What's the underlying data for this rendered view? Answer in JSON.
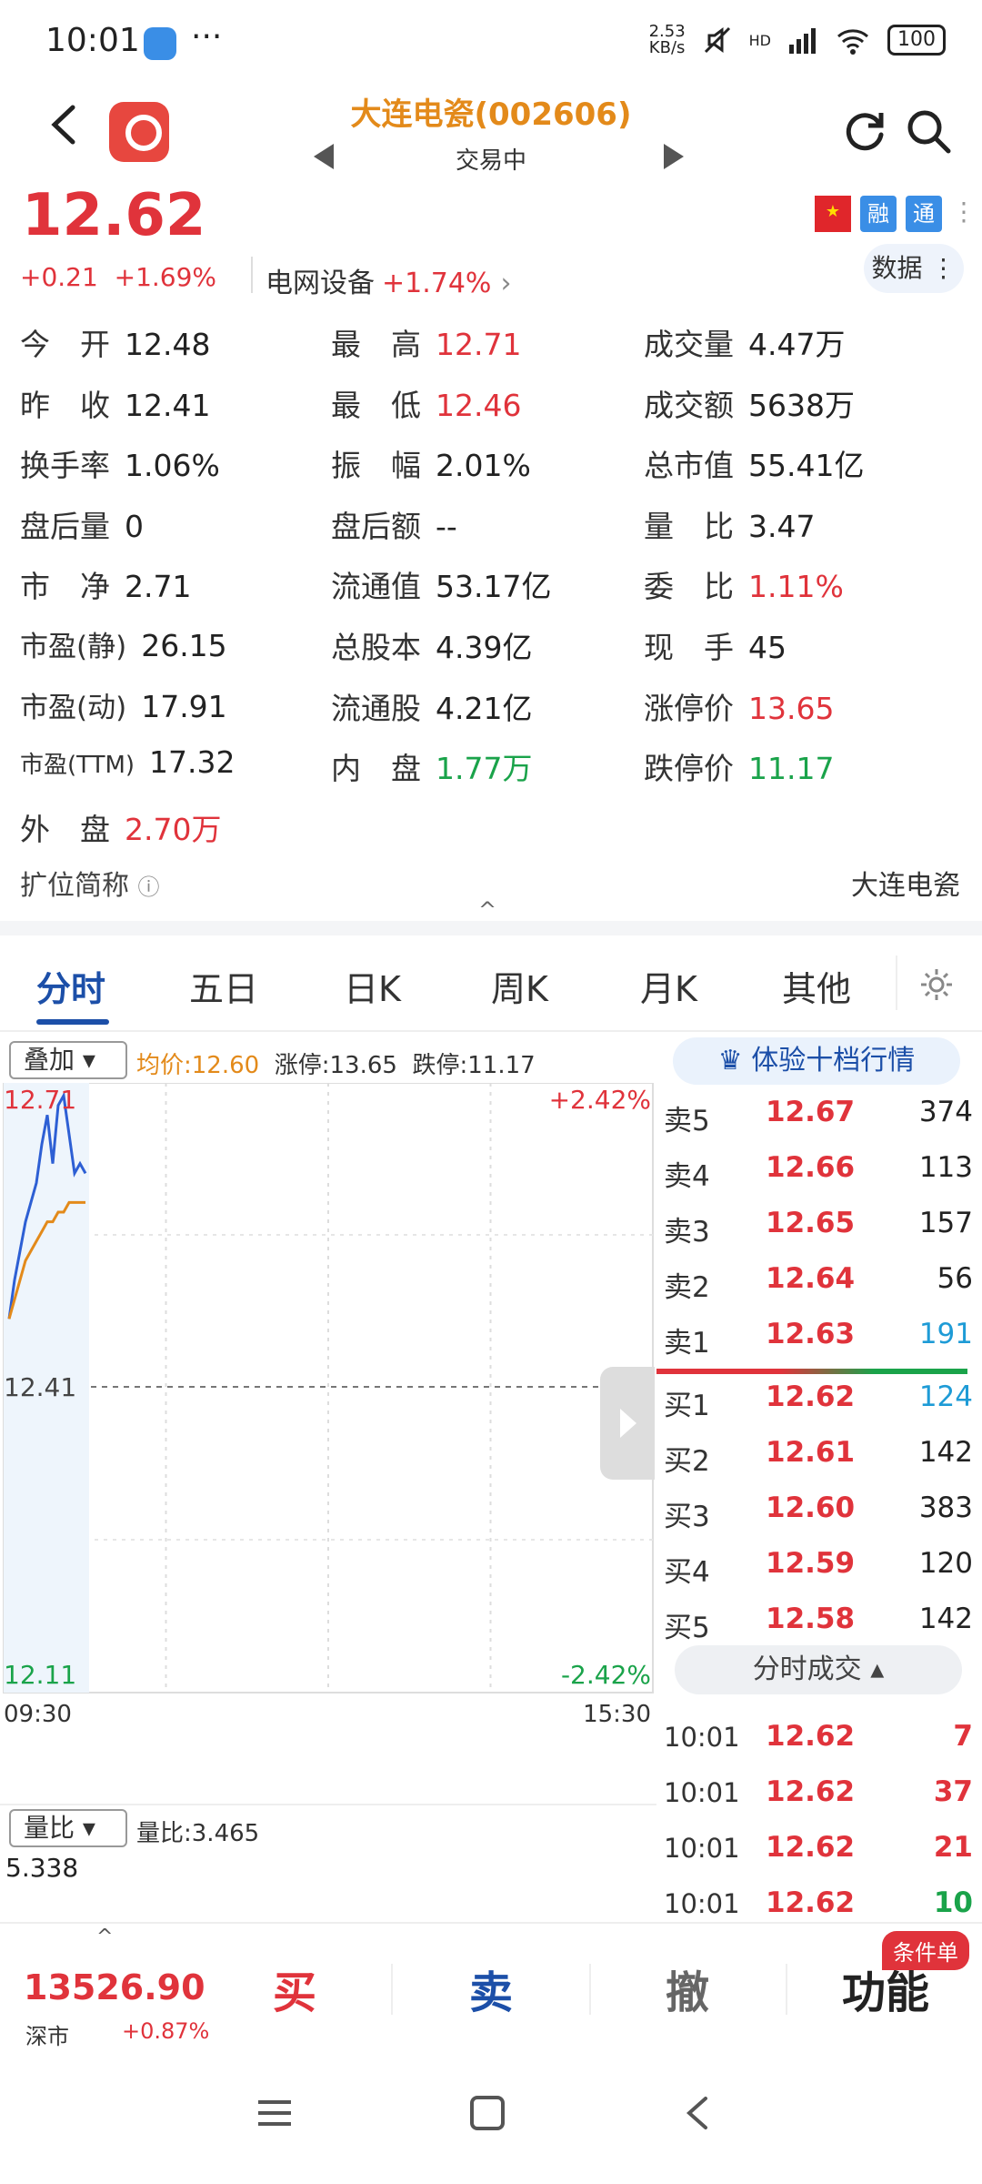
{
  "status_bar": {
    "time": "10:01",
    "more": "···",
    "net_speed_top": "2.53",
    "net_speed_unit": "KB/s",
    "hd": "HD",
    "battery": "100"
  },
  "header": {
    "title": "大连电瓷(002606)",
    "subtitle": "交易中"
  },
  "quote": {
    "price": "12.62",
    "change": "+0.21",
    "change_pct": "+1.69%",
    "sector_name": "电网设备",
    "sector_pct": "+1.74%",
    "data_btn": "数据",
    "badge_rong": "融",
    "badge_tong": "通"
  },
  "stats": [
    {
      "k": "今　开",
      "v": "12.48"
    },
    {
      "k": "最　高",
      "v": "12.71",
      "c": "red"
    },
    {
      "k": "成交量",
      "v": "4.47万"
    },
    {
      "k": "昨　收",
      "v": "12.41"
    },
    {
      "k": "最　低",
      "v": "12.46",
      "c": "red"
    },
    {
      "k": "成交额",
      "v": "5638万"
    },
    {
      "k": "换手率",
      "v": "1.06%"
    },
    {
      "k": "振　幅",
      "v": "2.01%"
    },
    {
      "k": "总市值",
      "v": "55.41亿"
    },
    {
      "k": "盘后量",
      "v": "0"
    },
    {
      "k": "盘后额",
      "v": "--"
    },
    {
      "k": "量　比",
      "v": "3.47"
    },
    {
      "k": "市　净",
      "v": "2.71"
    },
    {
      "k": "流通值",
      "v": "53.17亿"
    },
    {
      "k": "委　比",
      "v": "1.11%",
      "c": "red"
    },
    {
      "k": "市盈(静)",
      "v": "26.15"
    },
    {
      "k": "总股本",
      "v": "4.39亿"
    },
    {
      "k": "现　手",
      "v": "45"
    },
    {
      "k": "市盈(动)",
      "v": "17.91"
    },
    {
      "k": "流通股",
      "v": "4.21亿"
    },
    {
      "k": "涨停价",
      "v": "13.65",
      "c": "red"
    },
    {
      "k": "市盈(TTM)",
      "v": "17.32"
    },
    {
      "k": "内　盘",
      "v": "1.77万",
      "c": "green"
    },
    {
      "k": "跌停价",
      "v": "11.17",
      "c": "green"
    },
    {
      "k": "外　盘",
      "v": "2.70万",
      "c": "red"
    }
  ],
  "extension": {
    "label": "扩位简称",
    "value": "大连电瓷"
  },
  "tabs": [
    "分时",
    "五日",
    "日K",
    "周K",
    "月K",
    "其他"
  ],
  "chart": {
    "overlay_dropdown": "叠加",
    "avg_label": "均价:12.60",
    "limit_up_label": "涨停:13.65",
    "limit_down_label": "跌停:11.17",
    "y_high": "12.71",
    "y_mid": "12.41",
    "y_low": "12.11",
    "pct_high": "+2.42%",
    "pct_low": "-2.42%",
    "time_start": "09:30",
    "time_end": "15:30",
    "volratio_dropdown": "量比",
    "volratio_label": "量比:3.465",
    "volratio_max": "5.338"
  },
  "chart_data": {
    "type": "line",
    "ylim": [
      12.11,
      12.71
    ],
    "series": [
      {
        "name": "price",
        "values": [
          12.48,
          12.52,
          12.55,
          12.58,
          12.6,
          12.62,
          12.66,
          12.69,
          12.64,
          12.7,
          12.71,
          12.67,
          12.63,
          12.64,
          12.63
        ]
      },
      {
        "name": "avg",
        "values": [
          12.48,
          12.5,
          12.52,
          12.54,
          12.55,
          12.56,
          12.57,
          12.58,
          12.58,
          12.59,
          12.59,
          12.6,
          12.6,
          12.6,
          12.6
        ]
      }
    ]
  },
  "orderbook": {
    "header": "体验十档行情",
    "asks": [
      {
        "label": "卖5",
        "price": "12.67",
        "vol": "374"
      },
      {
        "label": "卖4",
        "price": "12.66",
        "vol": "113"
      },
      {
        "label": "卖3",
        "price": "12.65",
        "vol": "157"
      },
      {
        "label": "卖2",
        "price": "12.64",
        "vol": "56"
      },
      {
        "label": "卖1",
        "price": "12.63",
        "vol": "191"
      }
    ],
    "bids": [
      {
        "label": "买1",
        "price": "12.62",
        "vol": "124"
      },
      {
        "label": "买2",
        "price": "12.61",
        "vol": "142"
      },
      {
        "label": "买3",
        "price": "12.60",
        "vol": "383"
      },
      {
        "label": "买4",
        "price": "12.59",
        "vol": "120"
      },
      {
        "label": "买5",
        "price": "12.58",
        "vol": "142"
      }
    ],
    "trades_toggle": "分时成交",
    "trades": [
      {
        "time": "10:01",
        "price": "12.62",
        "vol": "7"
      },
      {
        "time": "10:01",
        "price": "12.62",
        "vol": "37"
      },
      {
        "time": "10:01",
        "price": "12.62",
        "vol": "21"
      },
      {
        "time": "10:01",
        "price": "12.62",
        "vol": "10"
      }
    ]
  },
  "bottom_bar": {
    "index_value": "13526.90",
    "index_name": "深市",
    "index_pct": "+0.87%",
    "buy": "买",
    "sell": "卖",
    "cancel": "撤",
    "func": "功能",
    "cond_badge": "条件单"
  },
  "colors": {
    "up": "#e0333b",
    "down": "#1aa34a",
    "accent": "#1c4fa8",
    "title": "#e38a1a"
  }
}
